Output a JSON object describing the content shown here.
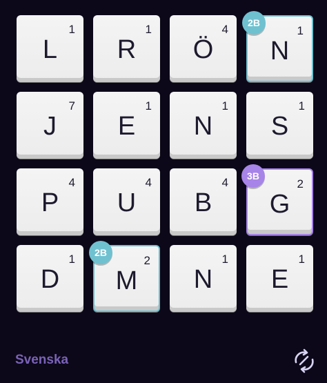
{
  "board": {
    "tiles": [
      {
        "letter": "L",
        "score": "1"
      },
      {
        "letter": "R",
        "score": "1"
      },
      {
        "letter": "Ö",
        "score": "4"
      },
      {
        "letter": "N",
        "score": "1",
        "bonus": "2B"
      },
      {
        "letter": "J",
        "score": "7"
      },
      {
        "letter": "E",
        "score": "1"
      },
      {
        "letter": "N",
        "score": "1"
      },
      {
        "letter": "S",
        "score": "1"
      },
      {
        "letter": "P",
        "score": "4"
      },
      {
        "letter": "U",
        "score": "4"
      },
      {
        "letter": "B",
        "score": "4"
      },
      {
        "letter": "G",
        "score": "2",
        "bonus": "3B"
      },
      {
        "letter": "D",
        "score": "1"
      },
      {
        "letter": "M",
        "score": "2",
        "bonus": "2B"
      },
      {
        "letter": "N",
        "score": "1"
      },
      {
        "letter": "E",
        "score": "1"
      }
    ]
  },
  "footer": {
    "language": "Svenska",
    "refresh_icon": "refresh-icon"
  },
  "colors": {
    "background": "#0c0819",
    "tile": "#f0f0f0",
    "text": "#1d1a2e",
    "bonus_2b": "#6fc1d0",
    "bonus_3b": "#a784e8",
    "language": "#7a62b8"
  }
}
